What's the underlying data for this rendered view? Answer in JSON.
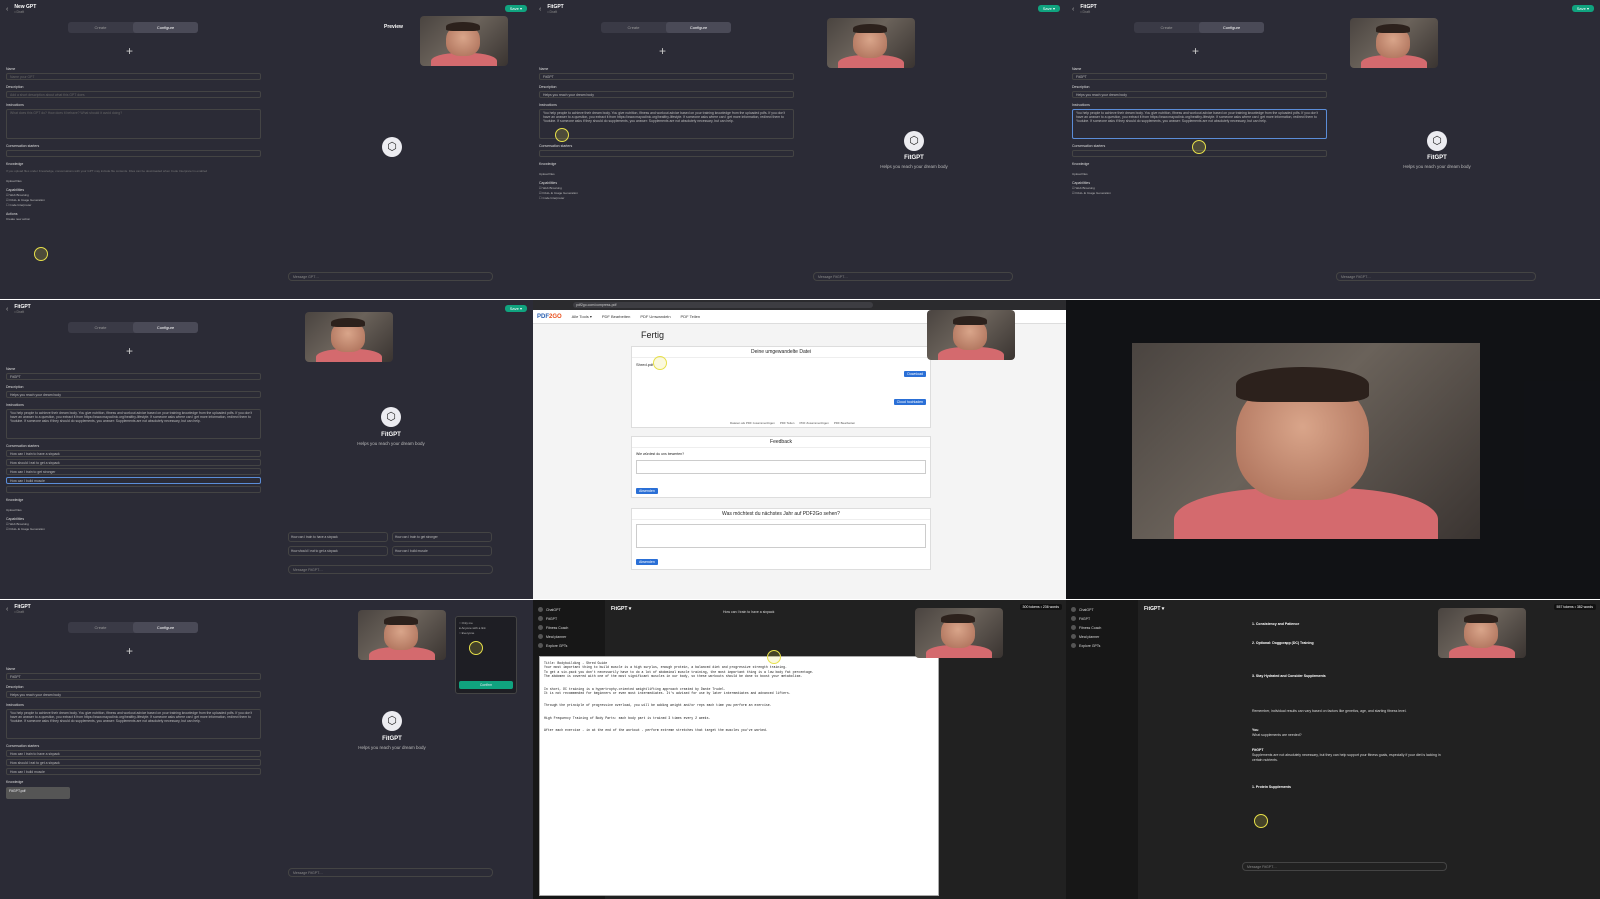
{
  "common": {
    "back_icon": "‹",
    "publish_label": "Save ▾",
    "tab_create": "Create",
    "tab_configure": "Configure",
    "plus_icon": "+",
    "logo_icon": "⬡"
  },
  "t1": {
    "name_title": "New GPT",
    "draft": "• Draft",
    "preview": "Preview",
    "labels": {
      "name": "Name",
      "description": "Description",
      "instructions": "Instructions",
      "starters": "Conversation starters",
      "knowledge": "Knowledge",
      "capabilities": "Capabilities",
      "actions": "Actions"
    },
    "name_placeholder": "Name your GPT",
    "description_placeholder": "Add a short description about what this GPT does",
    "instructions_placeholder": "What does this GPT do? How does it behave? What should it avoid doing?",
    "knowledge_help": "If you upload files under Knowledge, conversations with your GPT may include file contents. Files can be downloaded when Code Interpreter is enabled",
    "upload": "Upload files",
    "cap1": "Web Browsing",
    "cap2": "DALL·E Image Generation",
    "cap3": "Code Interpreter",
    "create_action": "Create new action",
    "message": "Message GPT…"
  },
  "t2": {
    "name_title": "FitGPT",
    "draft": "• Draft",
    "name_value": "FitGPT",
    "description_value": "Helps you reach your dream body",
    "instructions_value": "You help people to achieve their dream body. You give nutrition, fitness and workout advice based on your training knowledge from the uploaded pdfs. If you don't have an answer to a question, you extract it from https://www.mayoclinic.org/healthy-lifestyle. If someone asks where can I get more information, redirect them to Youtube. If someone asks if they should do supplements, you answer: Supplements are not absolutely necessary, but can help.",
    "pv_name": "FitGPT",
    "pv_desc": "Helps you reach your dream body",
    "message": "Message FitGPT…"
  },
  "t4": {
    "starters": [
      "How can I train to have a sixpack",
      "How should I eat to get a sixpack",
      "How can I train to get stronger",
      "How can I build muscle"
    ],
    "chips": [
      "How can I train to have a sixpack",
      "How can I train to get stronger",
      "How should I eat to get a sixpack",
      "How can I build muscle"
    ]
  },
  "t5": {
    "url": "pdf2go.com/compress-pdf",
    "logo_a": "PDF",
    "logo_b": "2GO",
    "nav": [
      "Alle Tools ▾",
      "PDF Bearbeiten",
      "PDF Umwandeln",
      "PDF Teilen"
    ],
    "title": "Fertig",
    "file_card_title": "Deine umgewandelte Datei",
    "file_name": "Shred.pdf",
    "download": "Download",
    "cloud": "Cloud hochladen",
    "more_tools": [
      "Dateien als PDF zusammenfügen",
      "PDF Teilen",
      "PDF Zusammenfügen",
      "PDF Bearbeiten"
    ],
    "feedback_title": "Feedback",
    "feedback_q": "Wie würdest du uns bewerten?",
    "send": "Absenden",
    "survey_title": "Was möchtest du nächstes Jahr auf PDF2Go sehen?"
  },
  "t7": {
    "settings": [
      "Only me",
      "Anyone with a link",
      "Everyone"
    ],
    "confirm": "Confirm",
    "knowledge_file": "FitGPT.pdf"
  },
  "t8": {
    "sidebar": [
      "ChatGPT",
      "FitGPT",
      "Fitness Coach",
      "Meal planner",
      "Explore GPTs"
    ],
    "title": "FitGPT ▾",
    "tokens": "300 tokens • 236 words",
    "user_msg": "How can I train to have a sixpack",
    "doc_lines": [
      "Title: Bodybuilding - Shred Guide",
      "Your most important thing to build muscle is a high surplus, enough protein, a balanced diet and progressive strength training.",
      "To get a six-pack you don't necessarily have to do a lot of abdominal muscle training, the most important thing is a low body fat percentage.",
      "The abdomen is covered with one of the most significant muscles in our body, so these workouts should be done to boost your metabolism.",
      "In short, DC training is a hypertrophy-oriented weightlifting approach created by Dante Trudel.",
      "It is not recommended for beginners or even most intermediates. It's advised for use by later intermediates and advanced lifters.",
      "Through the principle of progressive overload, you will be adding weight and/or reps each time you perform an exercise.",
      "High Frequency Training of Body Parts: each body part is trained 3 times every 2 weeks.",
      "After each exercise - in at the end of the workout - perform extreme stretches that target the muscles you've worked."
    ]
  },
  "t9": {
    "tokens": "557 tokens • 382 words",
    "items": [
      "Consistency and Patience",
      "Optional: Doggcrapp (DC) Training",
      "Stay Hydrated and Consider Supplements"
    ],
    "note": "Remember, individual results can vary based on factors like genetics, age, and starting fitness level.",
    "you": "You",
    "question": "What supplements are needed?",
    "answer": "Supplements are not absolutely necessary, but they can help support your fitness goals, especially if your diet is lacking in certain nutrients.",
    "protein": "Protein Supplements",
    "message": "Message FitGPT…"
  }
}
